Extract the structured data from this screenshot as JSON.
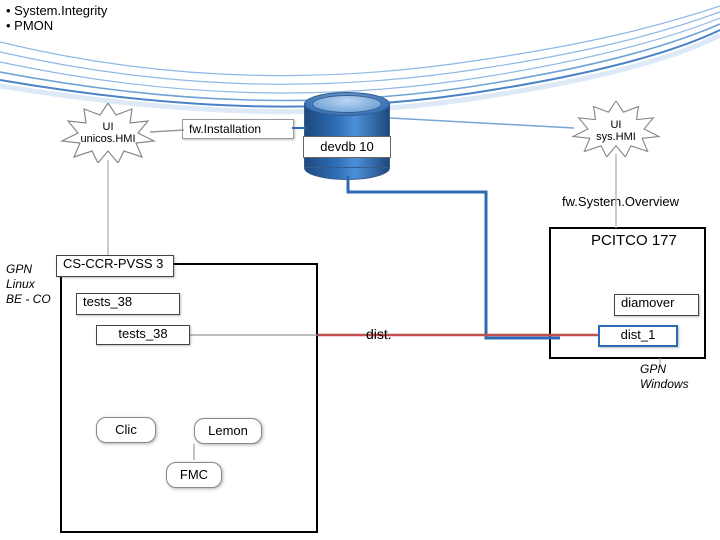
{
  "stars": {
    "left_label": "UI\nunicos.HMI",
    "right_label": "UI\nsys.HMI"
  },
  "fw_install": "fw.Installation",
  "cylinder_label": "devdb 10",
  "fw_sys_ov": "fw.System.Overview",
  "left_box": {
    "gpn": "GPN\nLinux\nBE - CO",
    "title": "CS-CCR-PVSS 3",
    "tests_a": "tests_38",
    "tests_b": "tests_38",
    "bullets": "• System.Integrity\n• PMON",
    "node_clic": "Clic",
    "node_lemon": "Lemon",
    "node_fmc": "FMC"
  },
  "dist_label": "dist.",
  "right_box": {
    "title": "PCITCO 177",
    "diamover": "diamover",
    "dist1": "dist_1",
    "gpn": "GPN\nWindows"
  }
}
